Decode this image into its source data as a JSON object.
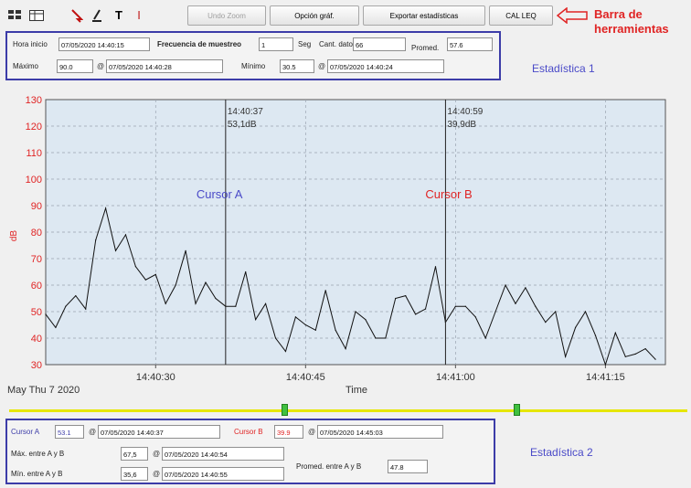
{
  "toolbar": {
    "undo_zoom": "Undo Zoom",
    "graph_options": "Opción gráf.",
    "export_stats": "Exportar estadísticas",
    "cal_leq": "CAL LEQ",
    "annotation": "Barra de herramientas",
    "icons": [
      "grid-toggle-icon",
      "arrow-pointer-icon",
      "cursor-tool-icon",
      "text-tool-icon",
      "marker-tool-icon"
    ]
  },
  "stats1": {
    "start_label": "Hora inicio",
    "start_value": "07/05/2020 14:40:15",
    "sample_rate_label": "Frecuencia de muestreo",
    "sample_rate_value": "1",
    "sample_rate_unit": "Seg",
    "data_count_label": "Cant. datos",
    "data_count_value": "66",
    "avg_label": "Promed.",
    "avg_value": "57.6",
    "max_label": "Máximo",
    "max_value": "90.0",
    "max_time": "07/05/2020 14:40:28",
    "min_label": "Mínimo",
    "min_value": "30.5",
    "min_time": "07/05/2020 14:40:24",
    "at_symbol": "@",
    "annotation": "Estadística 1"
  },
  "chart_data": {
    "type": "line",
    "xlabel": "Time",
    "ylabel": "dB",
    "date_label": "May Thu 7 2020",
    "ylim": [
      30,
      130
    ],
    "y_ticks": [
      30,
      40,
      50,
      60,
      70,
      80,
      90,
      100,
      110,
      120,
      130
    ],
    "x_ticks": [
      "14:40:30",
      "14:40:45",
      "14:41:00",
      "14:41:15"
    ],
    "x_start": "14:40:19",
    "x_end": "14:41:21",
    "grid": true,
    "series": [
      {
        "x": [
          "14:40:19",
          "14:40:20",
          "14:40:21",
          "14:40:22",
          "14:40:23",
          "14:40:24",
          "14:40:25",
          "14:40:26",
          "14:40:27",
          "14:40:28",
          "14:40:29",
          "14:40:30",
          "14:40:31",
          "14:40:32",
          "14:40:33",
          "14:40:34",
          "14:40:35",
          "14:40:36",
          "14:40:37",
          "14:40:38",
          "14:40:39",
          "14:40:40",
          "14:40:41",
          "14:40:42",
          "14:40:43",
          "14:40:44",
          "14:40:45",
          "14:40:46",
          "14:40:47",
          "14:40:48",
          "14:40:49",
          "14:40:50",
          "14:40:51",
          "14:40:52",
          "14:40:53",
          "14:40:54",
          "14:40:55",
          "14:40:56",
          "14:40:57",
          "14:40:58",
          "14:40:59",
          "14:41:00",
          "14:41:01",
          "14:41:02",
          "14:41:03",
          "14:41:04",
          "14:41:05",
          "14:41:06",
          "14:41:07",
          "14:41:08",
          "14:41:09",
          "14:41:10",
          "14:41:11",
          "14:41:12",
          "14:41:13",
          "14:41:14",
          "14:41:15",
          "14:41:16",
          "14:41:17",
          "14:41:18",
          "14:41:19",
          "14:41:20"
        ],
        "values": [
          49,
          44,
          52,
          56,
          51,
          77,
          89,
          73,
          79,
          67,
          62,
          64,
          53,
          60,
          73,
          53,
          61,
          55,
          52,
          52,
          65,
          47,
          53,
          40,
          35,
          48,
          45,
          43,
          58,
          43,
          36,
          50,
          47,
          40,
          40,
          55,
          56,
          49,
          51,
          67,
          46,
          52,
          52,
          48,
          40,
          50,
          60,
          53,
          59,
          52,
          46,
          50,
          33,
          44,
          50,
          41,
          30,
          42,
          33,
          34,
          36,
          32
        ]
      }
    ],
    "cursors": [
      {
        "name": "Cursor A",
        "time": "14:40:37",
        "value_label": "53,1dB"
      },
      {
        "name": "Cursor B",
        "time": "14:40:59",
        "value_label": "39,9dB"
      }
    ]
  },
  "slider": {
    "marker_a": "A",
    "marker_b": "B"
  },
  "stats2": {
    "cursor_a_label": "Cursor A",
    "cursor_a_value": "53.1",
    "cursor_a_time": "07/05/2020 14:40:37",
    "cursor_b_label": "Cursor B",
    "cursor_b_value": "39.9",
    "cursor_b_time": "07/05/2020 14:45:03",
    "max_ab_label": "Máx. entre A y B",
    "max_ab_value": "67,5",
    "max_ab_time": "07/05/2020 14:40:54",
    "min_ab_label": "Mín. entre A y B",
    "min_ab_value": "35,6",
    "min_ab_time": "07/05/2020 14:40:55",
    "avg_ab_label": "Promed. entre A y B",
    "avg_ab_value": "47.8",
    "at_symbol": "@",
    "annotation": "Estadística 2"
  },
  "colors": {
    "panel_border": "#3c3ca8",
    "plot_bg": "#dde8f2",
    "cursor_a_text": "#4a4ac8",
    "cursor_b_text": "#e02424",
    "slider_track": "#e6e600",
    "slider_handle": "#40c040"
  }
}
